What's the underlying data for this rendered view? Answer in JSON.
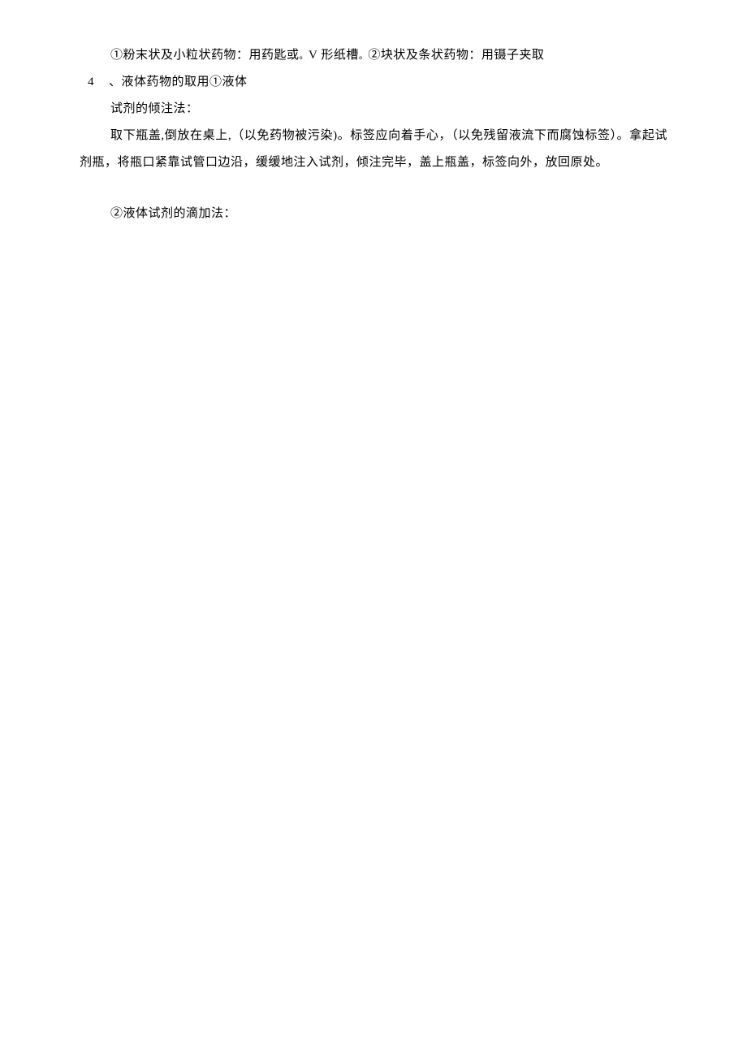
{
  "lines": {
    "l1_prefix": "①粉末状及小粒状药物：用药匙或",
    "l1_sub1": "。",
    "l1_mid": "V 形纸槽",
    "l1_sub2": "。",
    "l1_suffix": "②块状及条状药物：用镊子夹取",
    "l2_num": "4",
    "l2_text": "、液体药物的取用①液体",
    "l3": "试剂的倾注法：",
    "l4": "取下瓶盖,倒放在桌上,（以免药物被污染)。标签应向着手心，（以免残留液流下而腐蚀标签）。拿起试剂瓶，将瓶口紧靠试管口边沿，缓缓地注入试剂，倾注完毕，盖上瓶盖，标签向外，放回原处。",
    "l5": "②液体试剂的滴加法："
  }
}
